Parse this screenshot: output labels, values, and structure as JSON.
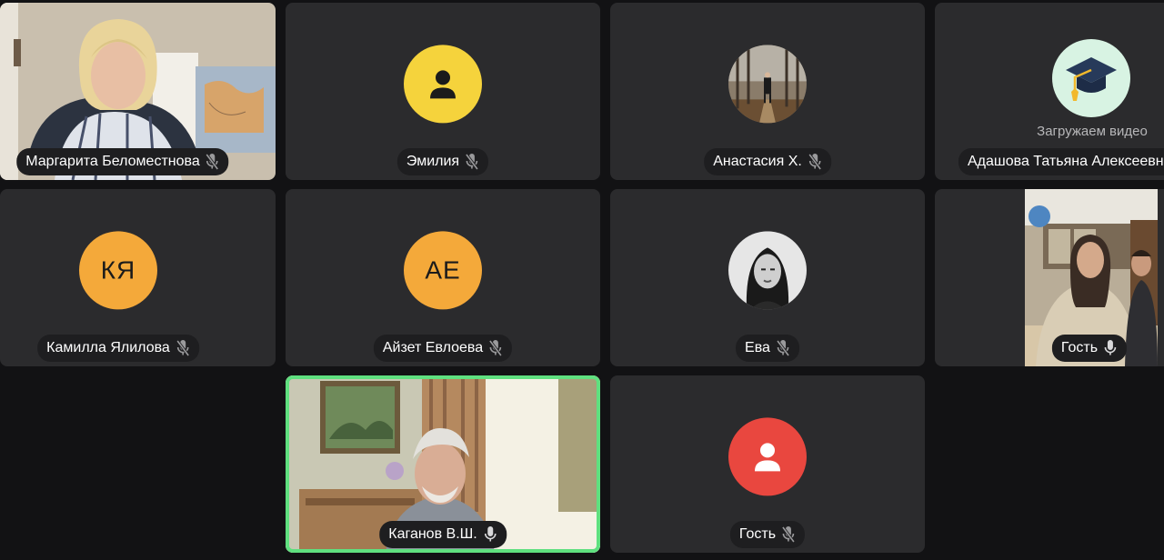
{
  "colors": {
    "background": "#121214",
    "tile": "#2b2b2d",
    "pill": "#1e1e20",
    "avatar_yellow": "#f5d33c",
    "avatar_orange": "#f4a93a",
    "avatar_red": "#e9473f",
    "avatar_mint": "#d8f3e3",
    "active_speaker": "#5fe07f"
  },
  "participants": [
    {
      "name": "Маргарита Беломестнова",
      "mic": "muted",
      "media": "video"
    },
    {
      "name": "Эмилия",
      "mic": "muted",
      "media": "avatar-yellow",
      "icon": "person-icon"
    },
    {
      "name": "Анастасия Х.",
      "mic": "muted",
      "media": "photo"
    },
    {
      "name": "Адашова Татьяна Алексеевна",
      "mic": "unknown",
      "media": "avatar-mint",
      "icon": "graduation-cap-icon",
      "status": "Загружаем видео"
    },
    {
      "name": "Камилла Ялилова",
      "mic": "muted",
      "media": "avatar-orange",
      "initials": "КЯ"
    },
    {
      "name": "Айзет Евлоева",
      "mic": "muted",
      "media": "avatar-orange",
      "initials": "АЕ"
    },
    {
      "name": "Ева",
      "mic": "muted",
      "media": "photo"
    },
    {
      "name": "Гость",
      "mic": "on",
      "media": "video"
    },
    {
      "name": "Каганов В.Ш.",
      "mic": "on",
      "media": "video",
      "active": true
    },
    {
      "name": "Гость",
      "mic": "muted",
      "media": "avatar-red",
      "icon": "person-icon"
    }
  ]
}
